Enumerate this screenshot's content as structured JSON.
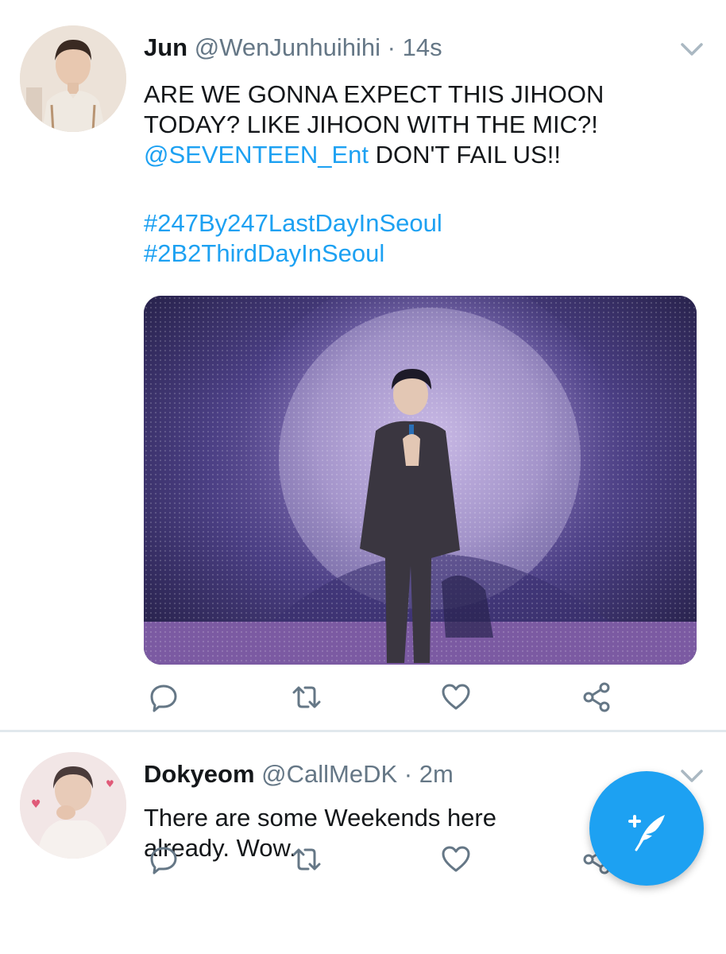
{
  "tweets": [
    {
      "name": "Jun",
      "handle": "@WenJunhuihihi",
      "separator": "·",
      "time": "14s",
      "text_lines": [
        {
          "text": "ARE WE GONNA EXPECT THIS JIHOON",
          "link": false
        },
        {
          "text": "TODAY? LIKE JIHOON WITH THE MIC?!",
          "link": false
        }
      ],
      "mention": "@SEVENTEEN_Ent",
      "mention_suffix": " DON'T FAIL US!!",
      "hashtags": [
        "#247By247LastDayInSeoul",
        "#2B2ThirdDayInSeoul"
      ],
      "media": {
        "icon": "photo",
        "description_icon": "concert-photo"
      }
    },
    {
      "name": "Dokyeom",
      "handle": "@CallMeDK",
      "separator": "·",
      "time": "2m",
      "text_lines": [
        {
          "text": "There are some Weekends here",
          "link": false
        },
        {
          "text": "already. Wow.",
          "link": false
        }
      ]
    }
  ],
  "icons": {
    "reply": "reply-icon",
    "retweet": "retweet-icon",
    "like": "heart-icon",
    "share": "share-icon",
    "menu": "chevron-down-icon",
    "compose": "compose-tweet-icon"
  },
  "colors": {
    "link": "#1da1f2",
    "secondary_text": "#657786",
    "action_icon": "#657786",
    "divider": "#e1e8ed",
    "fab": "#1da1f2"
  }
}
